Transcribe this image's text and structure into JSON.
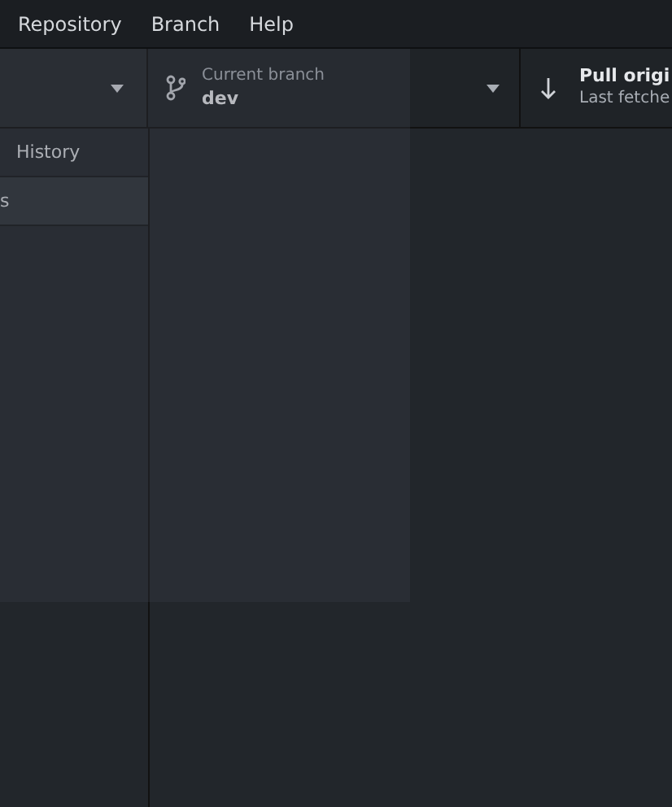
{
  "menu_bar": [
    "Repository",
    "Branch",
    "Help"
  ],
  "toolbar": {
    "current_branch": {
      "label": "Current branch",
      "value": "dev"
    },
    "pull": {
      "title": "Pull origi",
      "subtitle": "Last fetche"
    }
  },
  "sidebar": {
    "tabs": [
      {
        "label": "History",
        "selected": false
      },
      {
        "label": "s",
        "selected": true
      }
    ]
  }
}
